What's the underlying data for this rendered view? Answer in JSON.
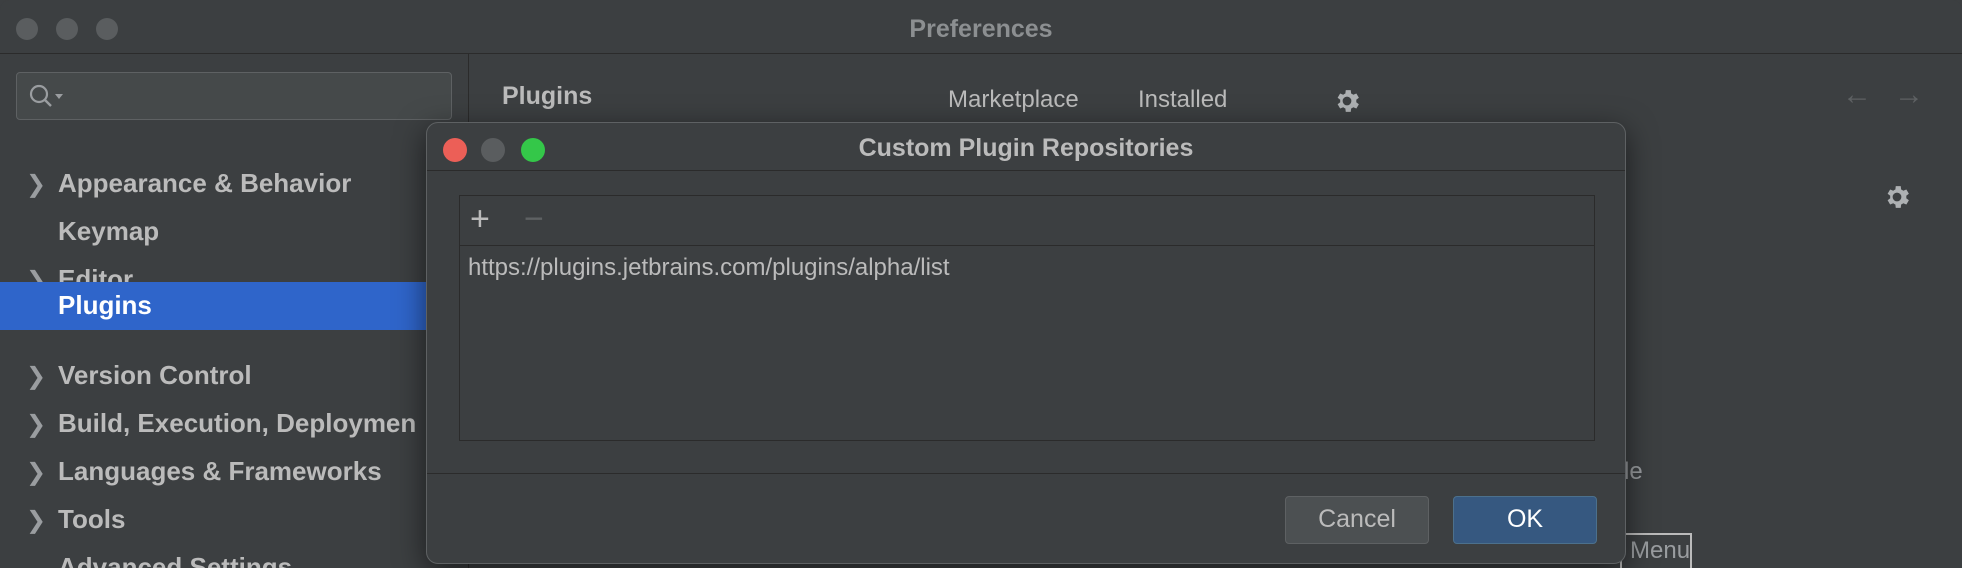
{
  "window": {
    "title": "Preferences"
  },
  "sidebar": {
    "search": {
      "placeholder": "",
      "value": ""
    },
    "items": [
      {
        "label": "Appearance & Behavior",
        "expandable": true,
        "selected": false
      },
      {
        "label": "Keymap",
        "expandable": false,
        "selected": false
      },
      {
        "label": "Editor",
        "expandable": true,
        "selected": false
      },
      {
        "label": "Plugins",
        "expandable": false,
        "selected": true
      },
      {
        "label": "Version Control",
        "expandable": true,
        "selected": false
      },
      {
        "label": "Build, Execution, Deploymen",
        "expandable": true,
        "selected": false
      },
      {
        "label": "Languages & Frameworks",
        "expandable": true,
        "selected": false
      },
      {
        "label": "Tools",
        "expandable": true,
        "selected": false
      },
      {
        "label": "Advanced Settings",
        "expandable": false,
        "selected": false
      }
    ]
  },
  "main": {
    "title": "Plugins",
    "tabs": [
      {
        "label": "Marketplace"
      },
      {
        "label": "Installed"
      }
    ],
    "background_fragments": {
      "partial_text": "le",
      "partial_button": "Menu"
    }
  },
  "dialog": {
    "title": "Custom Plugin Repositories",
    "toolbar": {
      "add_label": "+",
      "remove_label": "−"
    },
    "repositories": [
      "https://plugins.jetbrains.com/plugins/alpha/list"
    ],
    "buttons": {
      "cancel": "Cancel",
      "ok": "OK"
    }
  },
  "colors": {
    "selection": "#2f65ca",
    "ok_button": "#365880",
    "close_dot": "#ec5f57",
    "minimize_dot": "#5a5d5f",
    "zoom_dot": "#34c749"
  },
  "icons": [
    "search-icon",
    "gear-icon",
    "arrow-left-icon",
    "arrow-right-icon",
    "chevron-right-icon"
  ]
}
